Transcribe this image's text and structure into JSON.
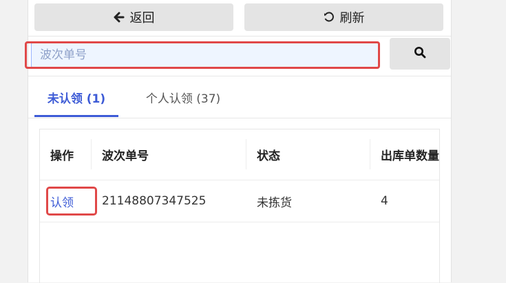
{
  "topbar": {
    "back_label": "返回",
    "refresh_label": "刷新"
  },
  "search": {
    "placeholder": "波次单号",
    "value": ""
  },
  "tabs": [
    {
      "label": "未认领 (1)",
      "active": true
    },
    {
      "label": "个人认领 (37)",
      "active": false
    }
  ],
  "table": {
    "headers": [
      "操作",
      "波次单号",
      "状态",
      "出库单数量"
    ],
    "rows": [
      {
        "action": "认领",
        "wave_no": "21148807347525",
        "status": "未拣货",
        "outbound_count": "4"
      }
    ]
  },
  "colors": {
    "accent": "#3d5bd6",
    "highlight": "#e04848",
    "button_bg": "#e4e4e4"
  },
  "icons": {
    "back": "arrow-left-icon",
    "refresh": "refresh-icon",
    "search": "search-icon"
  }
}
